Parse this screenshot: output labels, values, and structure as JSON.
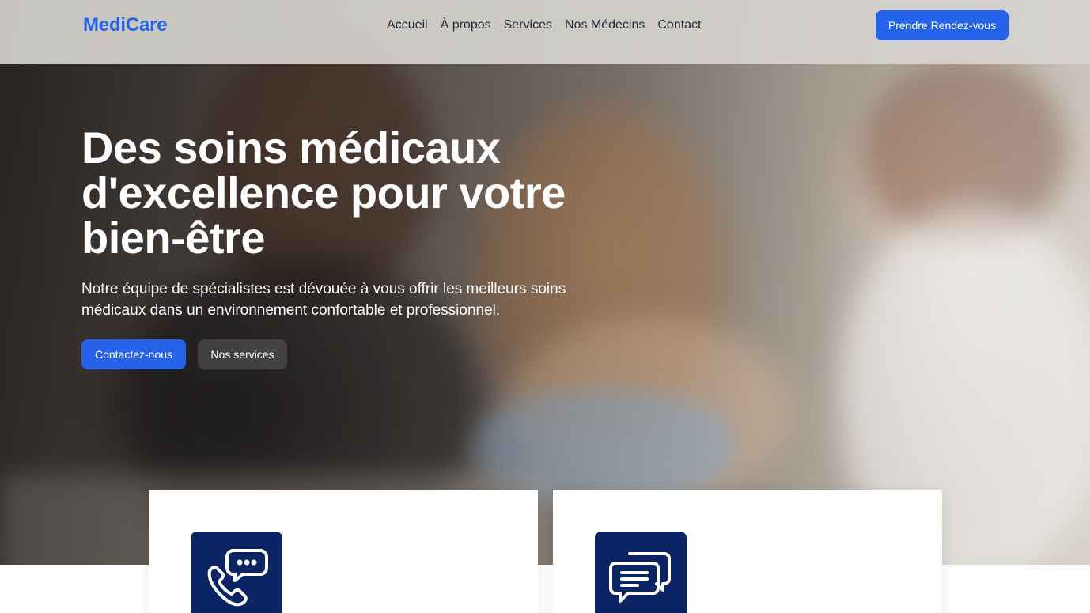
{
  "header": {
    "logo": "MediCare",
    "nav": [
      "Accueil",
      "À propos",
      "Services",
      "Nos Médecins",
      "Contact"
    ],
    "cta_label": "Prendre Rendez-vous"
  },
  "hero": {
    "title": "Des soins médicaux d'excellence pour votre bien-être",
    "subtitle": "Notre équipe de spécialistes est dévouée à vous offrir les meilleurs soins médicaux dans un environnement confortable et professionnel.",
    "primary_button": "Contactez-nous",
    "secondary_button": "Nos services"
  },
  "cards": [
    {
      "icon": "phone-chat-icon"
    },
    {
      "icon": "chat-bubbles-icon"
    }
  ],
  "colors": {
    "brand": "#2563eb",
    "icon_bg": "#0b2463",
    "header_bg": "#d6d4cf"
  }
}
